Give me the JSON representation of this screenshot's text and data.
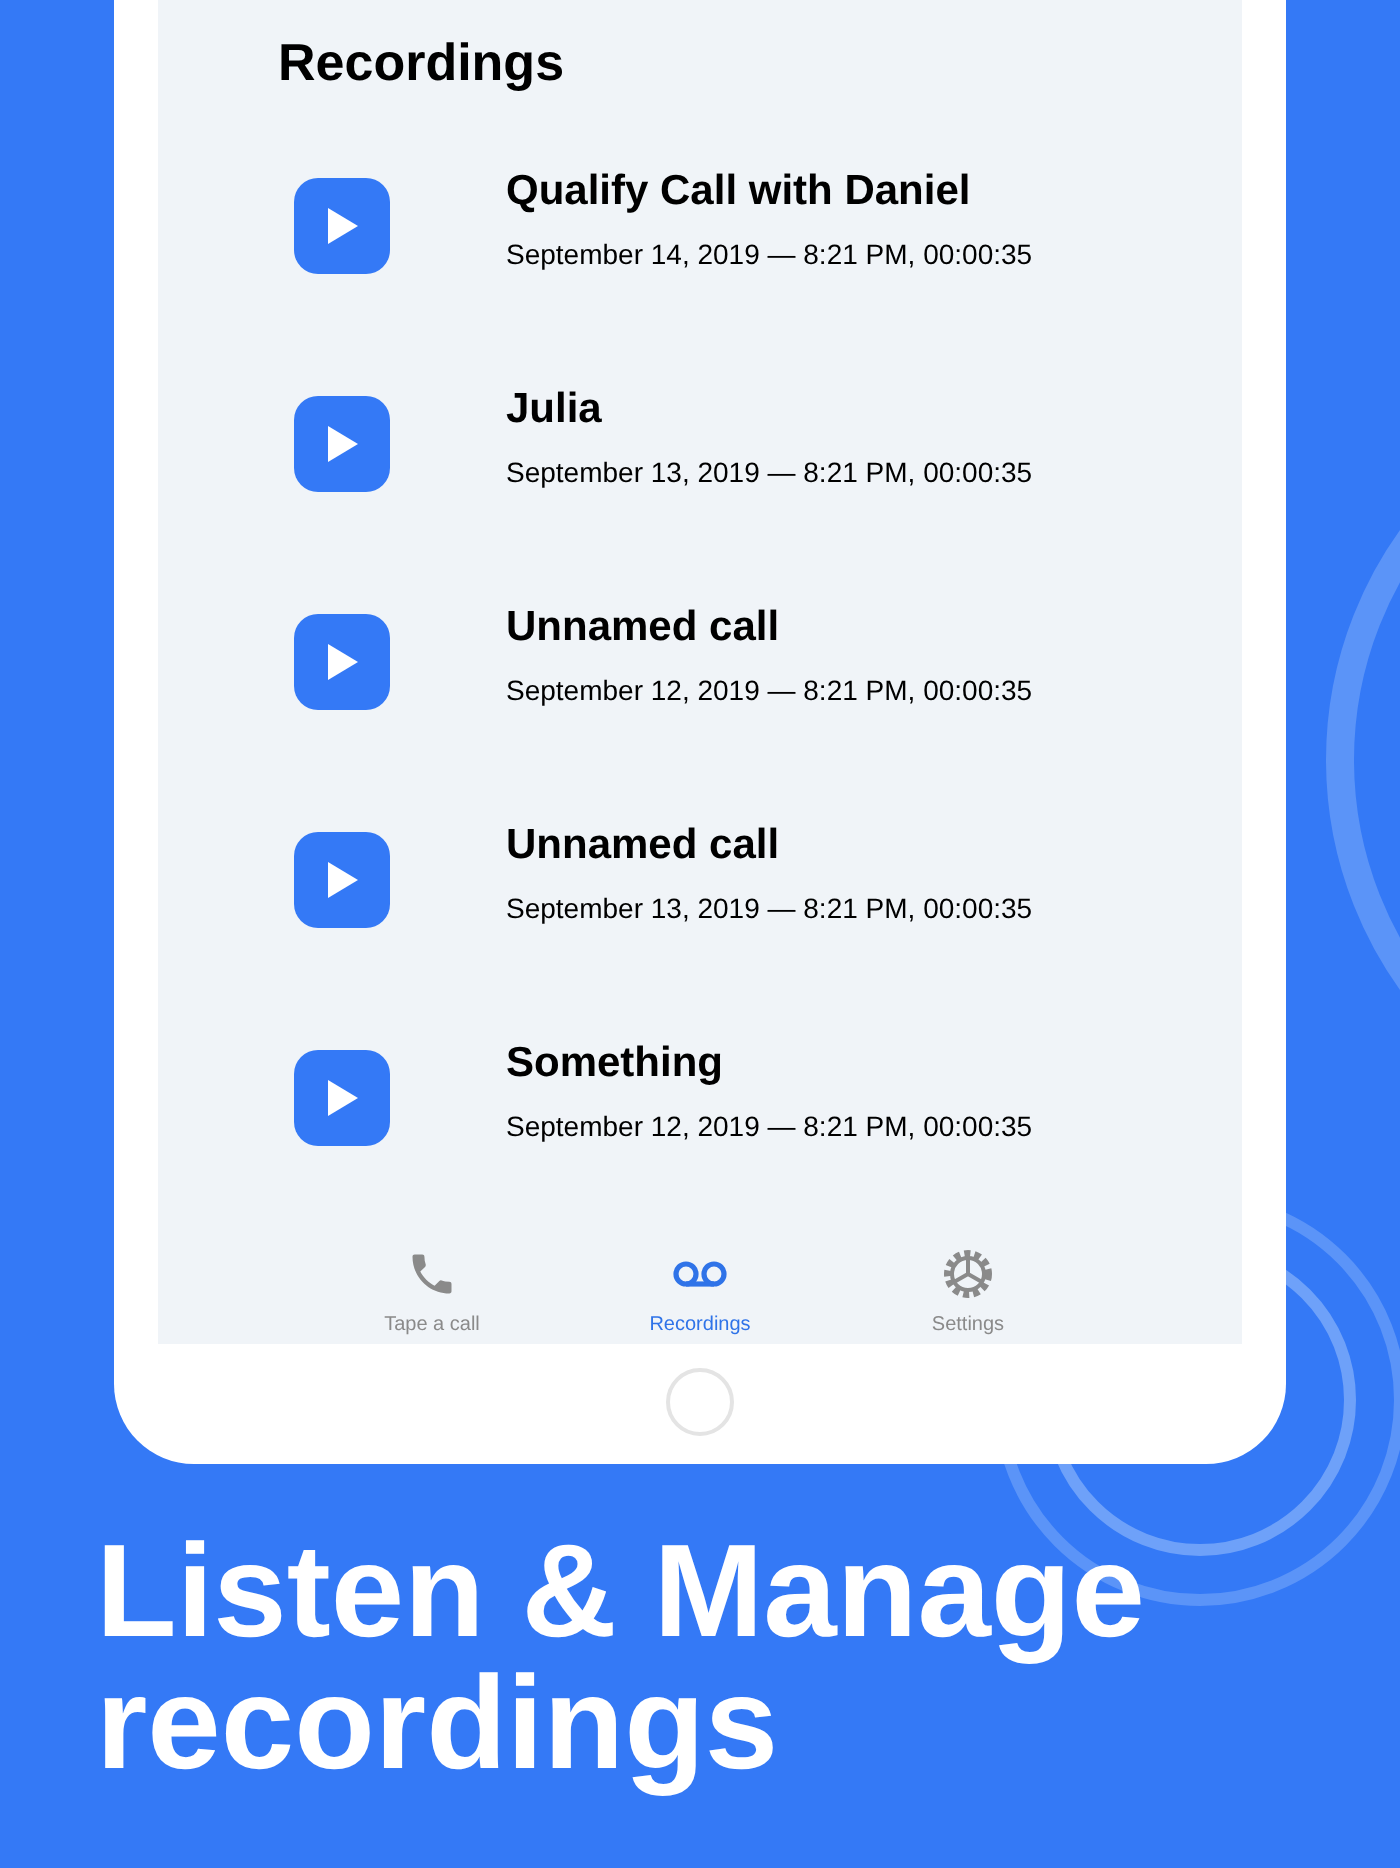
{
  "screen": {
    "title": "Recordings",
    "recordings": [
      {
        "title": "Qualify Call with Daniel",
        "details": "September 14, 2019 — 8:21 PM, 00:00:35"
      },
      {
        "title": "Julia",
        "details": "September 13, 2019 — 8:21 PM, 00:00:35"
      },
      {
        "title": "Unnamed call",
        "details": "September 12, 2019 — 8:21 PM, 00:00:35"
      },
      {
        "title": "Unnamed call",
        "details": "September 13, 2019 — 8:21 PM, 00:00:35"
      },
      {
        "title": "Something",
        "details": "September 12, 2019 — 8:21 PM, 00:00:35"
      }
    ],
    "tabs": [
      {
        "kind": "phone",
        "label": "Tape a call",
        "selected": false
      },
      {
        "kind": "voicemail",
        "label": "Recordings",
        "selected": true
      },
      {
        "kind": "gear",
        "label": "Settings",
        "selected": false
      }
    ]
  },
  "headline": "Listen & Manage recordings"
}
